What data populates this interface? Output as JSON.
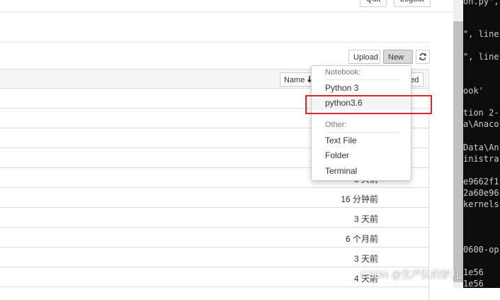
{
  "header": {
    "btn_left": "Quit",
    "btn_right": "Logout"
  },
  "toolbar": {
    "upload_label": "Upload",
    "new_label": "New"
  },
  "list_header": {
    "name_sort_label": "Name",
    "last_modified_label": "Last Modified"
  },
  "rows": [
    {
      "time": ""
    },
    {
      "time": ""
    },
    {
      "time": ""
    },
    {
      "time": ""
    },
    {
      "time": "3 天前"
    },
    {
      "time": "16 分钟前"
    },
    {
      "time": "3 天前"
    },
    {
      "time": "6 个月前"
    },
    {
      "time": "3 天前"
    },
    {
      "time": "4 天前"
    }
  ],
  "dropdown": {
    "notebook_header": "Notebook:",
    "notebook_items": [
      "Python 3",
      "python3.6"
    ],
    "other_header": "Other:",
    "other_items": [
      "Text File",
      "Folder",
      "Terminal"
    ]
  },
  "terminal_lines": [
    "on.py\",",
    "\", line",
    "\", line",
    "ook'",
    "tion 2-",
    "a\\Anaco",
    "Data\\An",
    "inistra",
    "e9662f1",
    "2a60e96",
    "kernels",
    "0600-op",
    "1e56",
    "1e56"
  ],
  "watermark": "CSDN @生产队的驴儿"
}
